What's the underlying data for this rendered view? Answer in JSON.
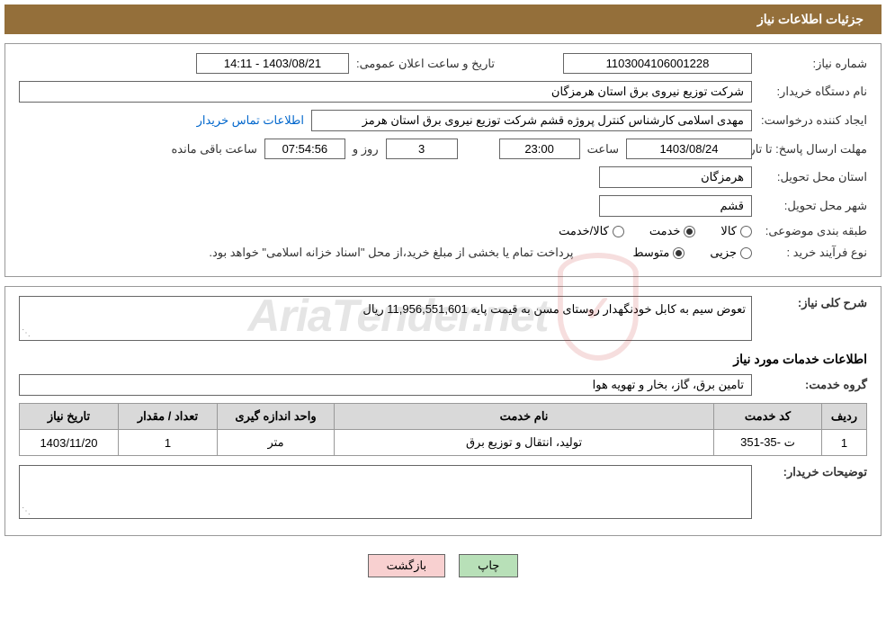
{
  "header": {
    "title": "جزئیات اطلاعات نیاز"
  },
  "fields": {
    "need_number_label": "شماره نیاز:",
    "need_number": "1103004106001228",
    "announce_date_label": "تاریخ و ساعت اعلان عمومی:",
    "announce_date": "1403/08/21 - 14:11",
    "buyer_org_label": "نام دستگاه خریدار:",
    "buyer_org": "شرکت توزیع نیروی برق استان هرمزگان",
    "requester_label": "ایجاد کننده درخواست:",
    "requester": "مهدی اسلامی کارشناس کنترل پروژه قشم شرکت توزیع نیروی برق استان هرمز",
    "buyer_contact_link": "اطلاعات تماس خریدار",
    "deadline_label": "مهلت ارسال پاسخ: تا تاریخ:",
    "deadline_date": "1403/08/24",
    "time_label": "ساعت",
    "deadline_time": "23:00",
    "days_remaining": "3",
    "days_and_label": "روز و",
    "time_remaining": "07:54:56",
    "hours_remaining_label": "ساعت باقی مانده",
    "delivery_province_label": "استان محل تحویل:",
    "delivery_province": "هرمزگان",
    "delivery_city_label": "شهر محل تحویل:",
    "delivery_city": "قشم",
    "category_label": "طبقه بندی موضوعی:",
    "cat_goods": "کالا",
    "cat_service": "خدمت",
    "cat_goods_service": "کالا/خدمت",
    "purchase_type_label": "نوع فرآیند خرید :",
    "pt_minor": "جزیی",
    "pt_medium": "متوسط",
    "payment_note": "پرداخت تمام یا بخشی از مبلغ خرید،از محل \"اسناد خزانه اسلامی\" خواهد بود.",
    "general_desc_label": "شرح کلی نیاز:",
    "general_desc": "تعوض سیم به کابل خودنگهدار روستای مسن به قیمت پایه 11,956,551,601 ریال",
    "services_info_title": "اطلاعات خدمات مورد نیاز",
    "service_group_label": "گروه خدمت:",
    "service_group": "تامین برق، گاز، بخار و تهویه هوا",
    "buyer_notes_label": "توضیحات خریدار:",
    "buyer_notes": ""
  },
  "table": {
    "headers": {
      "row": "ردیف",
      "code": "کد خدمت",
      "name": "نام خدمت",
      "unit": "واحد اندازه گیری",
      "qty": "تعداد / مقدار",
      "need_date": "تاریخ نیاز"
    },
    "rows": [
      {
        "row": "1",
        "code": "ت -35-351",
        "name": "تولید، انتقال و توزیع برق",
        "unit": "متر",
        "qty": "1",
        "need_date": "1403/11/20"
      }
    ]
  },
  "buttons": {
    "print": "چاپ",
    "back": "بازگشت"
  },
  "watermark": "AriaTender.net"
}
